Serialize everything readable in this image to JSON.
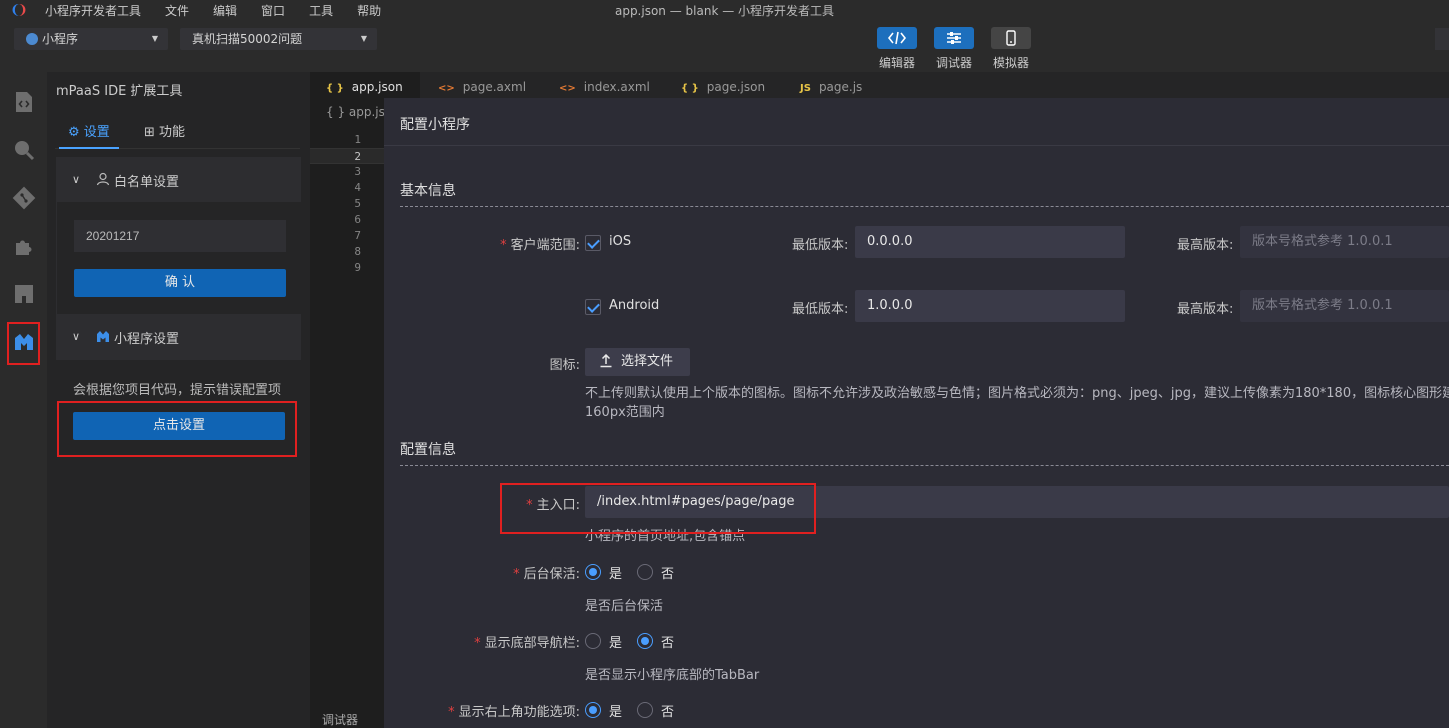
{
  "app": {
    "menus": [
      "小程序开发者工具",
      "文件",
      "编辑",
      "窗口",
      "工具",
      "帮助"
    ],
    "window_title": "app.json — blank — 小程序开发者工具"
  },
  "toolbar": {
    "project_select": "小程序",
    "compile_select": "真机扫描50002问题",
    "editor_label": "编辑器",
    "debugger_label": "调试器",
    "simulator_label": "模拟器"
  },
  "extension": {
    "title": "mPaaS IDE 扩展工具",
    "tab_settings": "设置",
    "tab_features": "功能",
    "whitelist_title": "白名单设置",
    "whitelist_value": "20201217",
    "confirm_label": "确 认",
    "miniprogram_title": "小程序设置",
    "miniprogram_desc": "会根据您项目代码，提示错误配置项",
    "miniprogram_button": "点击设置"
  },
  "editor": {
    "tabs": [
      {
        "icon": "{ }",
        "label": "app.json"
      },
      {
        "icon": "<>",
        "label": "page.axml"
      },
      {
        "icon": "<>",
        "label": "index.axml"
      },
      {
        "icon": "{ }",
        "label": "page.json"
      },
      {
        "icon": "JS",
        "label": "page.js"
      }
    ],
    "breadcrumb": "{ } app.json",
    "line_numbers": [
      "1",
      "2",
      "3",
      "4",
      "5",
      "6",
      "7",
      "8",
      "9"
    ],
    "bottom_tab": "调试器"
  },
  "dialog": {
    "title": "配置小程序",
    "basic_section": "基本信息",
    "client_range_label": "客户端范围:",
    "ios_label": "iOS",
    "android_label": "Android",
    "min_version_label": "最低版本:",
    "max_version_label": "最高版本:",
    "ios_min_version": "0.0.0.0",
    "android_min_version": "1.0.0.0",
    "max_version_placeholder": "版本号格式参考 1.0.0.1",
    "icon_label": "图标:",
    "choose_file": "选择文件",
    "icon_hint_line1": "不上传则默认使用上个版本的图标。图标不允许涉及政治敏感与色情；图片格式必须为：png、jpeg、jpg，建议上传像素为180*180，图标核心图形建议",
    "icon_hint_line2": "160px范围内",
    "config_section": "配置信息",
    "main_entry_label": "主入口:",
    "main_entry_value": "/index.html#pages/page/page",
    "main_entry_hint": "小程序的首页地址,包含锚点",
    "keepalive_label": "后台保活:",
    "keepalive_hint": "是否后台保活",
    "tabbar_label": "显示底部导航栏:",
    "tabbar_hint": "是否显示小程序底部的TabBar",
    "topright_label": "显示右上角功能选项:",
    "yes": "是",
    "no": "否"
  },
  "colors": {
    "accent": "#1064b4",
    "highlight": "#e02020",
    "radio_active": "#4a9eff"
  }
}
